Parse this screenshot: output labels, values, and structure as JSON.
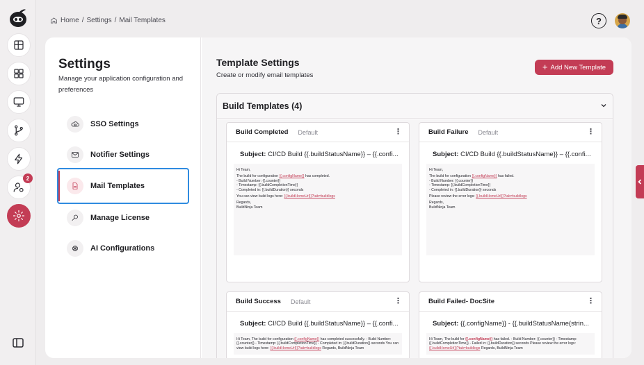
{
  "breadcrumb": {
    "home": "Home",
    "sep1": "/",
    "settings": "Settings",
    "sep2": "/",
    "current": "Mail Templates"
  },
  "topbar": {
    "help_glyph": "?",
    "help_icon": "help-circle-icon",
    "avatar_icon": "user-avatar"
  },
  "rail": {
    "items": [
      {
        "icon": "layout-panels-icon"
      },
      {
        "icon": "grid-icon"
      },
      {
        "icon": "monitor-icon"
      },
      {
        "icon": "git-branch-icon"
      },
      {
        "icon": "lightning-icon"
      },
      {
        "icon": "user-settings-icon",
        "badge": "2"
      },
      {
        "icon": "gear-icon",
        "active": true
      }
    ],
    "collapse_icon": "sidebar-collapse-icon"
  },
  "settings": {
    "title": "Settings",
    "description": "Manage your application configuration and preferences",
    "nav": [
      {
        "label": "SSO Settings",
        "icon": "cloud-lock-icon"
      },
      {
        "label": "Notifier Settings",
        "icon": "mail-icon"
      },
      {
        "label": "Mail Templates",
        "icon": "document-icon",
        "active": true
      },
      {
        "label": "Manage License",
        "icon": "key-icon"
      },
      {
        "label": "AI Configurations",
        "icon": "openai-icon"
      }
    ]
  },
  "templates": {
    "title": "Template Settings",
    "subtitle": "Create or modify email templates",
    "add_button": "Add New Template",
    "add_icon": "plus-icon",
    "section_title": "Build Templates (4)",
    "chevron_icon": "chevron-down-icon",
    "cards": [
      {
        "name": "Build Completed",
        "tag": "Default",
        "subject_label": "Subject:",
        "subject": "CI/CD Build {{.buildStatusName}} – {{.confi...",
        "greeting": "Hi Team,",
        "line1_pre": "The build for configuration",
        "line1_var": "{{.configName}}",
        "line1_post": "has completed.",
        "bullets": [
          "- Build Number: {{.counter}}",
          "- Timestamp: {{.buildCompletionTime}}",
          "- Completed in: {{.buildDuration}} seconds"
        ],
        "link_pre": "You can view build logs here:",
        "link": "{{.buildHomeUrl}}?tab=buildlogs",
        "sign1": "Regards,",
        "sign2": "BuildNinja Team"
      },
      {
        "name": "Build Failure",
        "tag": "Default",
        "subject_label": "Subject:",
        "subject": "CI/CD Build {{.buildStatusName}} – {{.confi...",
        "greeting": "Hi Team,",
        "line1_pre": "The build for configuration",
        "line1_var": "{{.configName}}",
        "line1_post": "has failed.",
        "bullets": [
          "- Build Number: {{.counter}}",
          "- Timestamp: {{.buildCompletionTime}}",
          "- Completed in: {{.buildDuration}} seconds"
        ],
        "link_pre": "Please review the error logs:",
        "link": "{{.buildHomeUrl}}?tab=buildlogs",
        "sign1": "Regards,",
        "sign2": "BuildNinja Team"
      },
      {
        "name": "Build Success",
        "tag": "Default",
        "subject_label": "Subject:",
        "subject": "CI/CD Build {{.buildStatusName}} – {{.confi...",
        "body_pre": "Hi Team, The build for configuration",
        "body_var": "{{.configName}}",
        "body_post": "has completed successfully. - Build Number: {{.counter}} - Timestamp: {{.buildCompletionTime}} - Completed in: {{.buildDuration}} seconds You can view build logs here:",
        "body_link": "{{.buildHomeUrl}}?tab=buildlogs",
        "body_end": "Regards, BuildNinja Team"
      },
      {
        "name": "Build Failed- DocSite",
        "tag": "",
        "subject_label": "Subject:",
        "subject": "{{.configName}} - {{.buildStatusName(strin...",
        "body_pre": "Hi Team, The build for",
        "body_var": "{{.configName}}",
        "body_post": "has failed. - Build Number: {{.counter}} - Timestamp: {{.buildCompletionTime}} - Failed in: {{.buildDuration}} seconds Please review the error logs:",
        "body_link": "{{.buildHomeUrl}}?tab=buildlogs",
        "body_end": "Regards, BuildNinja Team"
      }
    ]
  },
  "side_tab_icon": "chevron-left-icon",
  "colors": {
    "accent": "#c33c55",
    "focus": "#2f8be0"
  }
}
